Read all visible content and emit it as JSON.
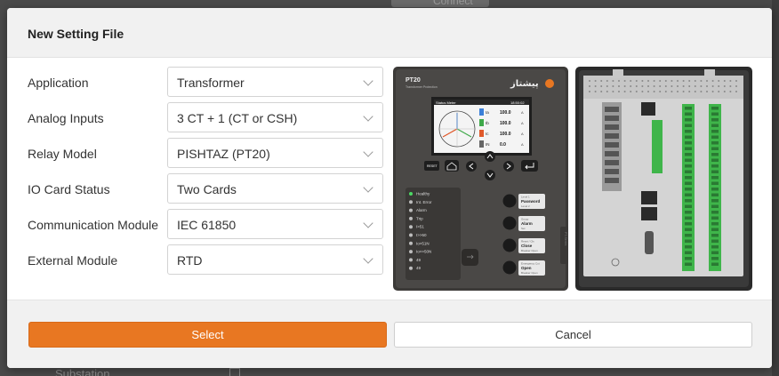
{
  "backdrop": {
    "connect_label": "Connect",
    "substation_label": "Substation"
  },
  "dialog": {
    "title": "New Setting File",
    "fields": [
      {
        "label": "Application",
        "value": "Transformer"
      },
      {
        "label": "Analog Inputs",
        "value": "3 CT + 1 (CT or CSH)"
      },
      {
        "label": "Relay Model",
        "value": "PISHTAZ (PT20)"
      },
      {
        "label": "IO Card Status",
        "value": "Two Cards"
      },
      {
        "label": "Communication Module",
        "value": "IEC 61850"
      },
      {
        "label": "External Module",
        "value": "RTD"
      }
    ],
    "device": {
      "model": "PT20",
      "model_sub": "Transformer Protection",
      "brand": "پیشتاز",
      "screen_header": "Status Meter",
      "screen_time": "18:50:02",
      "meter_rows": [
        {
          "name": "Ia",
          "value": "100.0",
          "unit": "A",
          "color": "#3b7fd8"
        },
        {
          "name": "Ib",
          "value": "100.0",
          "unit": "A",
          "color": "#3fa94a"
        },
        {
          "name": "Ic",
          "value": "100.0",
          "unit": "A",
          "color": "#e0592a"
        },
        {
          "name": "IN",
          "value": "0.0",
          "unit": "A",
          "color": "#666666"
        }
      ],
      "leds": [
        "Healthy",
        "Int. Error",
        "Alarm",
        "Trip",
        "I>51",
        "I>>50",
        "Io>51N",
        "Io>>50N",
        "49",
        "49"
      ],
      "func_buttons": [
        {
          "top": "Level 1",
          "main": "Password",
          "bottom": "Level 2"
        },
        {
          "top": "Group",
          "main": "Alarm",
          "bottom": "Set"
        },
        {
          "top": "Reset / Cls",
          "main": "Close",
          "bottom": "Breaker Open"
        },
        {
          "top": "Emergency Cut",
          "main": "Open",
          "bottom": "Breaker Open"
        }
      ],
      "side_label": "PT-Series",
      "reset_label": "RESET"
    },
    "select_label": "Select",
    "cancel_label": "Cancel"
  },
  "colors": {
    "accent": "#e87722",
    "device_panel": "#4a4846",
    "terminal_green": "#3fb54a",
    "led_green": "#4cd964"
  }
}
